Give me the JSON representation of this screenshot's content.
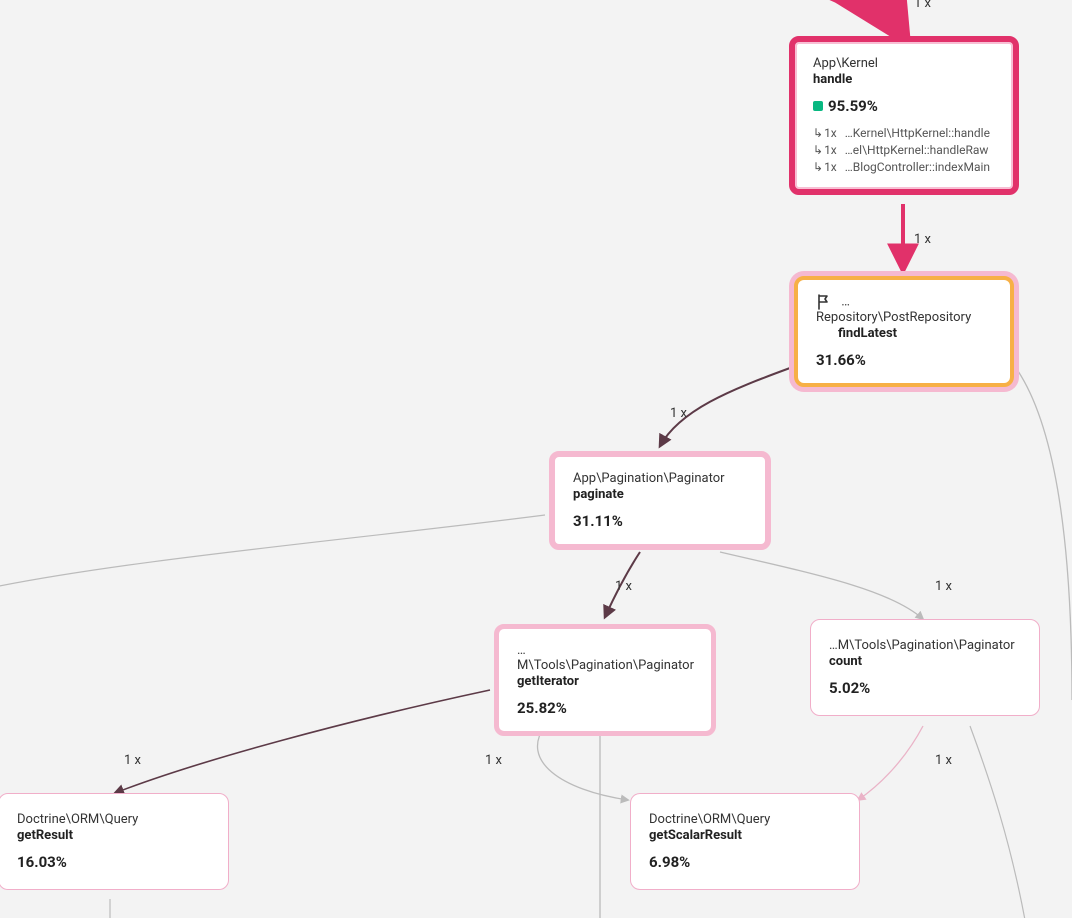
{
  "nodes": {
    "kernel": {
      "namespace": "App\\Kernel",
      "function": "handle",
      "percent": "95.59%",
      "calls": [
        {
          "count": "1x",
          "target": "…Kernel\\HttpKernel::handle"
        },
        {
          "count": "1x",
          "target": "…el\\HttpKernel::handleRaw"
        },
        {
          "count": "1x",
          "target": "…BlogController::indexMain"
        }
      ]
    },
    "repo": {
      "namespace": "…Repository\\PostRepository",
      "function": "findLatest",
      "percent": "31.66%"
    },
    "paginate": {
      "namespace": "App\\Pagination\\Paginator",
      "function": "paginate",
      "percent": "31.11%"
    },
    "iterator": {
      "namespace": "…M\\Tools\\Pagination\\Paginator",
      "function": "getIterator",
      "percent": "25.82%"
    },
    "count": {
      "namespace": "…M\\Tools\\Pagination\\Paginator",
      "function": "count",
      "percent": "5.02%"
    },
    "result": {
      "namespace": "Doctrine\\ORM\\Query",
      "function": "getResult",
      "percent": "16.03%"
    },
    "scalar": {
      "namespace": "Doctrine\\ORM\\Query",
      "function": "getScalarResult",
      "percent": "6.98%"
    }
  },
  "edgeLabels": {
    "in_kernel": "1 x",
    "kernel_repo": "1 x",
    "repo_paginate": "1 x",
    "paginate_iterator": "1 x",
    "paginate_count": "1 x",
    "iterator_result": "1 x",
    "iterator_scalar": "1 x",
    "count_scalar": "1 x"
  },
  "colors": {
    "accent": "#e1316a",
    "accentLight": "#f5b9d0",
    "orange": "#f7b046",
    "green": "#08b881",
    "gray": "#bbbbbb",
    "dark": "#5c3a47"
  }
}
